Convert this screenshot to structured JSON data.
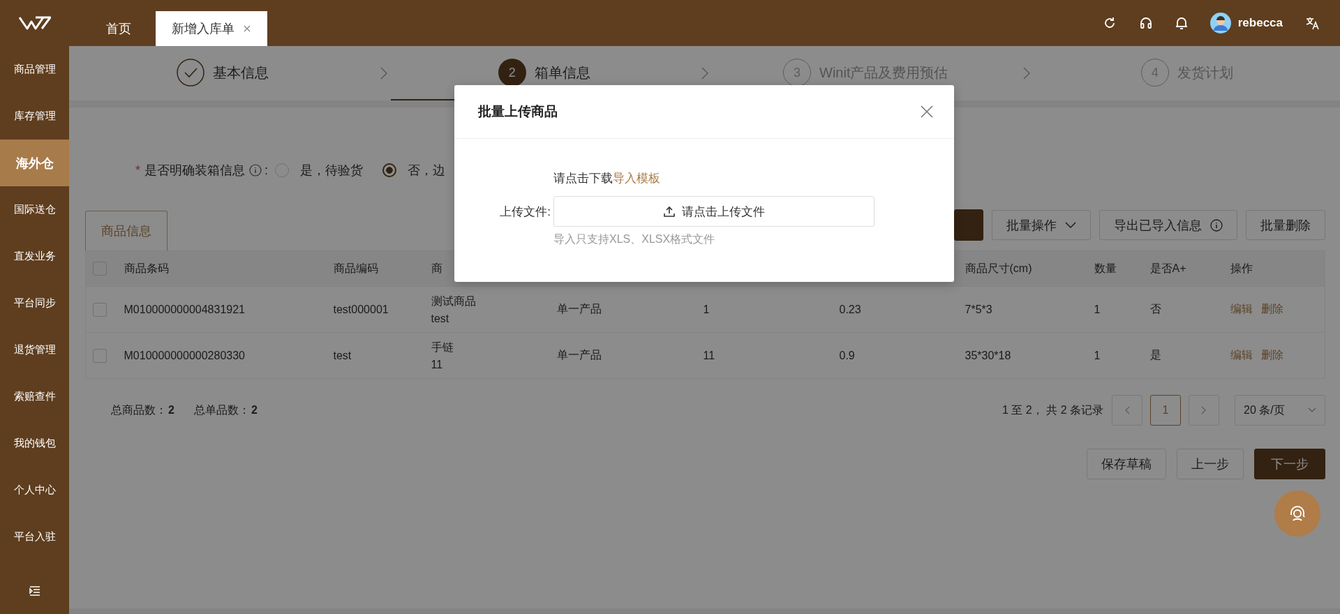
{
  "header": {
    "tabs": [
      {
        "label": "首页",
        "selected": false,
        "closable": false
      },
      {
        "label": "新增入库单",
        "selected": true,
        "closable": true
      }
    ],
    "user": {
      "name": "rebecca"
    }
  },
  "sidebar": {
    "items": [
      {
        "label": "商品管理",
        "selected": false
      },
      {
        "label": "库存管理",
        "selected": false
      },
      {
        "label": "海外仓",
        "selected": true
      },
      {
        "label": "国际送仓",
        "selected": false
      },
      {
        "label": "直发业务",
        "selected": false
      },
      {
        "label": "平台同步",
        "selected": false
      },
      {
        "label": "退货管理",
        "selected": false
      },
      {
        "label": "索赔查件",
        "selected": false
      },
      {
        "label": "我的钱包",
        "selected": false
      },
      {
        "label": "个人中心",
        "selected": false
      },
      {
        "label": "平台入驻",
        "selected": false
      }
    ]
  },
  "steps": [
    {
      "label": "基本信息",
      "completed": true,
      "selected": false
    },
    {
      "number": "2",
      "label": "箱单信息",
      "completed": false,
      "selected": true
    },
    {
      "number": "3",
      "label": "Winit产品及费用预估",
      "completed": false,
      "selected": false
    },
    {
      "number": "4",
      "label": "发货计划",
      "completed": false,
      "selected": false
    }
  ],
  "form": {
    "required_mark": "*",
    "label": "是否明确装箱信息",
    "colon": ":",
    "options": [
      {
        "label": "是，待验货",
        "selected": false
      },
      {
        "label": "否，边",
        "selected": true
      }
    ]
  },
  "section_tab": {
    "label": "商品信息"
  },
  "toolbar": [
    {
      "kind": "primary"
    },
    {
      "kind": "dropdown",
      "label": "批量操作"
    },
    {
      "kind": "info",
      "label": "导出已导入信息"
    },
    {
      "kind": "plain",
      "label": "批量删除"
    }
  ],
  "table": {
    "header_checked": false,
    "columns": [
      {
        "label": "商品条码"
      },
      {
        "label": "商品编码"
      },
      {
        "label": "商"
      },
      {},
      {},
      {},
      {
        "label": "商品尺寸(cm)"
      },
      {
        "label": "数量"
      },
      {
        "label": "是否A+"
      },
      {
        "label": "操作"
      }
    ],
    "rows": [
      {
        "checked": false,
        "cells": [
          "M010000000004831921",
          "test000001",
          [
            "测试商品",
            "test"
          ],
          "单一产品",
          "1",
          "0.23",
          "7*5*3",
          "1",
          "否"
        ],
        "actions": [
          "编辑",
          "删除"
        ]
      },
      {
        "checked": false,
        "cells": [
          "M010000000000280330",
          "test",
          [
            "手链",
            "11"
          ],
          "单一产品",
          "11",
          "0.9",
          "35*30*18",
          "1",
          "是"
        ],
        "actions": [
          "编辑",
          "删除"
        ]
      }
    ]
  },
  "summary": [
    {
      "label": "总商品数：",
      "value": "2"
    },
    {
      "label": "总单品数：",
      "value": "2"
    }
  ],
  "pagination": {
    "range": "1 至 2， 共 2 条记录",
    "pages": [
      {
        "label": "1",
        "selected": true
      }
    ],
    "page_size": "20 条/页"
  },
  "footer_buttons": [
    {
      "label": "保存草稿",
      "kind": "default"
    },
    {
      "label": "上一步",
      "kind": "default"
    },
    {
      "label": "下一步",
      "kind": "primary"
    }
  ],
  "modal": {
    "title": "批量上传商品",
    "download_text": "请点击下载",
    "download_link": "导入模板",
    "upload_label": "上传文件:",
    "upload_button": "请点击上传文件",
    "hint": "导入只支持XLS、XLSX格式文件"
  }
}
